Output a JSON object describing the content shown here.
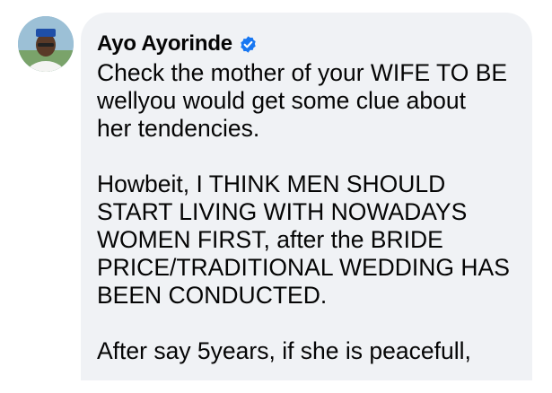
{
  "comment": {
    "author": {
      "name": "Ayo Ayorinde",
      "avatar_icon": "profile-photo-avatar",
      "verified_icon": "verified-badge-icon"
    },
    "paragraphs": [
      {
        "lines": [
          "Check the mother of your WIFE TO BE",
          "wellyou would get some clue about",
          "her tendencies."
        ]
      },
      {
        "lines": [
          "Howbeit, I THINK MEN SHOULD",
          "START LIVING WITH NOWADAYS",
          "WOMEN FIRST, after the BRIDE",
          "PRICE/TRADITIONAL WEDDING HAS",
          "BEEN CONDUCTED."
        ]
      },
      {
        "lines": [
          "After say 5years, if she is peacefull,"
        ]
      }
    ]
  },
  "colors": {
    "bubble_background": "#f0f2f5",
    "text": "#050505",
    "verified_blue": "#1877f2"
  }
}
